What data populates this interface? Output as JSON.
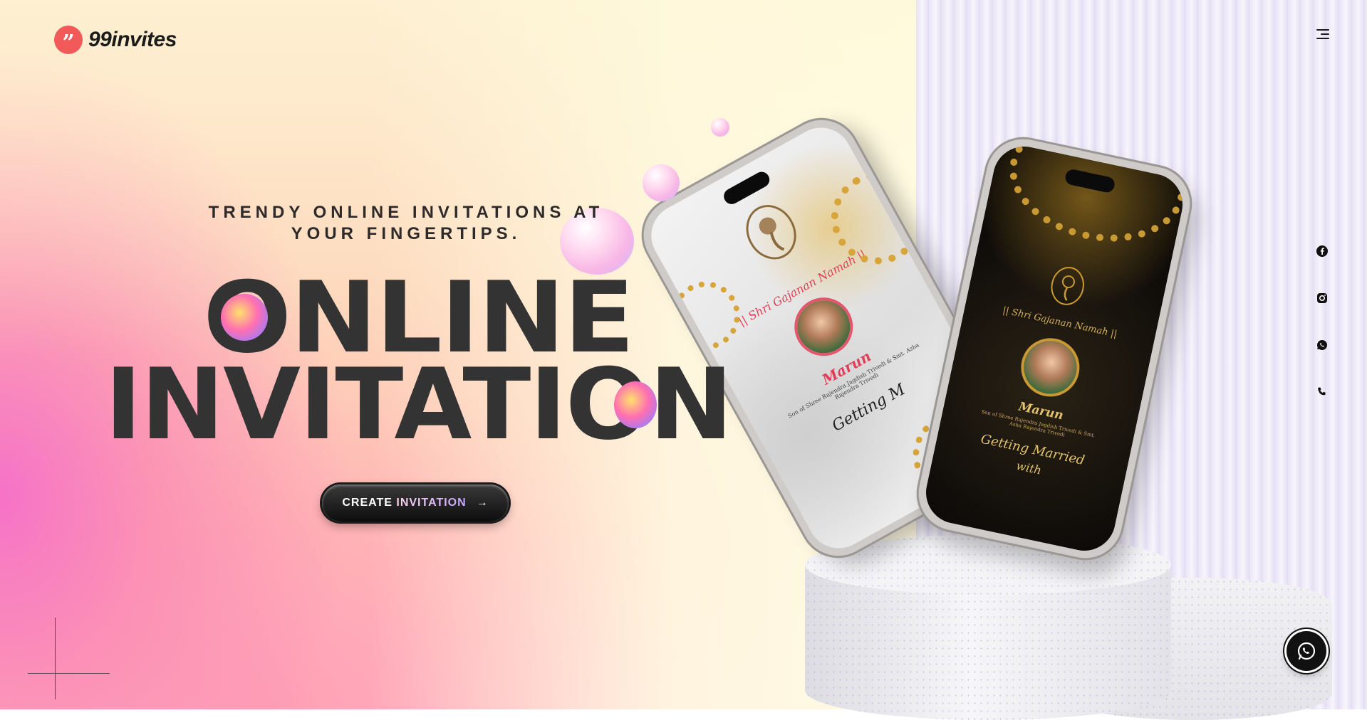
{
  "brand": {
    "logo_mark": "”",
    "name": "99invites",
    "accent": "#f25a5a"
  },
  "nav": {
    "menu_icon": "hamburger-icon"
  },
  "social": [
    {
      "icon": "facebook-icon"
    },
    {
      "icon": "instagram-icon"
    },
    {
      "icon": "whatsapp-icon"
    },
    {
      "icon": "phone-icon"
    }
  ],
  "hero": {
    "tagline": "TRENDY ONLINE INVITATIONS AT YOUR FINGERTIPS.",
    "headline_line1": "ONLINE",
    "headline_line2": "INVITATION",
    "cta_prefix": "CREATE",
    "cta_main": "INVITATION",
    "cta_arrow": "→"
  },
  "phones": {
    "white": {
      "invocation": "|| Shri Gajanan Namah ||",
      "name": "Marun",
      "parents": "Son of Shree Rajendra Jagdish Trivedi & Smt. Asha Rajendra Trivedi",
      "phrase": "Getting M"
    },
    "black": {
      "invocation": "|| Shri Gajanan Namah ||",
      "name": "Marun",
      "parents": "Son of Shree Rajendra Jagdish Trivedi & Smt. Asha Rajendra Trivedi",
      "phrase_line1": "Getting Married",
      "phrase_line2": "with"
    }
  },
  "floating": {
    "whatsapp_icon": "whatsapp-icon"
  }
}
